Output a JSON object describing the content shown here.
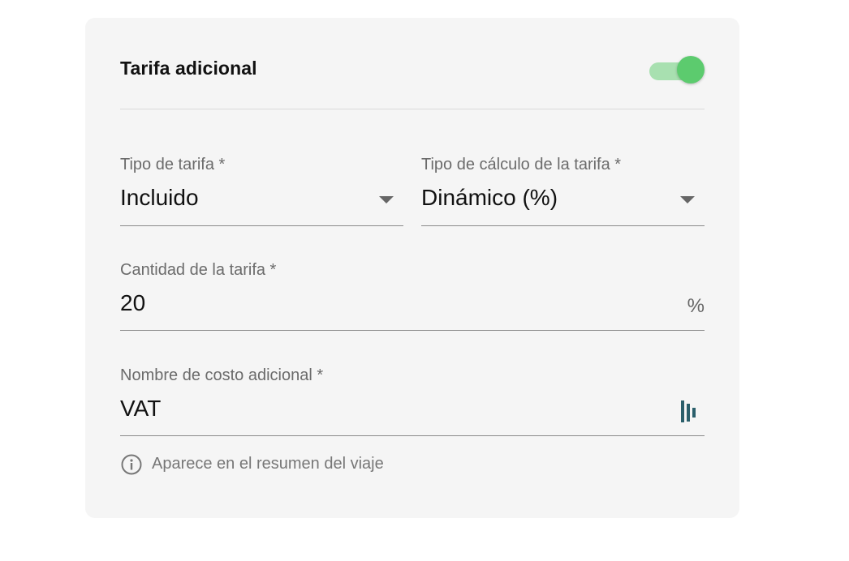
{
  "card": {
    "title": "Tarifa adicional",
    "toggle": {
      "checked": true,
      "accent_color": "#5ccb6e",
      "track_color": "#a8e0b0"
    }
  },
  "fields": {
    "tipo_tarifa": {
      "label": "Tipo de tarifa *",
      "value": "Incluido",
      "icon": "dropdown-arrow-icon"
    },
    "tipo_calculo": {
      "label": "Tipo de cálculo de la tarifa *",
      "value": "Dinámico (%)",
      "icon": "dropdown-arrow-icon"
    },
    "cantidad": {
      "label": "Cantidad de la tarifa *",
      "value": "20",
      "suffix": "%"
    },
    "nombre_costo": {
      "label": "Nombre de costo adicional *",
      "value": "VAT",
      "icon": "dashlane-icon",
      "icon_color": "#2b5f6b"
    }
  },
  "helper": {
    "icon": "info-icon",
    "text": "Aparece en el resumen del viaje"
  }
}
